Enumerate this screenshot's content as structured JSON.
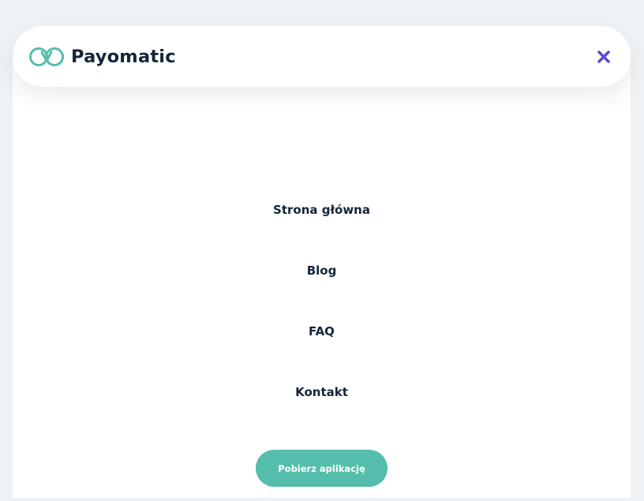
{
  "brand": {
    "name": "Payomatic",
    "icon": "logo-rings-icon",
    "accent_color": "#55bdab"
  },
  "header": {
    "close_icon": "close-icon",
    "close_color": "#5a4fcf"
  },
  "nav": {
    "items": [
      {
        "label": "Strona główna"
      },
      {
        "label": "Blog"
      },
      {
        "label": "FAQ"
      },
      {
        "label": "Kontakt"
      }
    ]
  },
  "cta": {
    "label": "Pobierz aplikację",
    "color": "#55bdab"
  }
}
